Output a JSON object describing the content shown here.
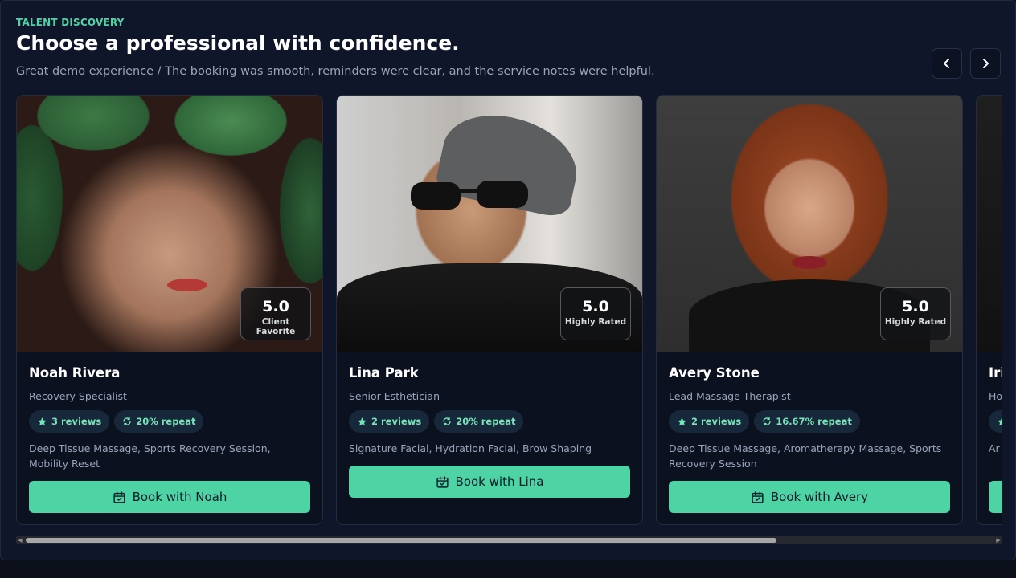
{
  "header": {
    "eyebrow": "TALENT DISCOVERY",
    "title": "Choose a professional with confidence.",
    "subtitle": "Great demo experience / The booking was smooth, reminders were clear, and the service notes were helpful."
  },
  "nav": {
    "prev_icon": "chevron-left-icon",
    "next_icon": "chevron-right-icon"
  },
  "colors": {
    "accent": "#4ed4a4",
    "background": "#0f1629",
    "card": "#0c1120"
  },
  "professionals": [
    {
      "name": "Noah Rivera",
      "role": "Recovery Specialist",
      "rating": "5.0",
      "rating_label": "Client Favorite",
      "reviews": "3 reviews",
      "repeat": "20% repeat",
      "services": "Deep Tissue Massage, Sports Recovery Session, Mobility Reset",
      "book_label": "Book with Noah"
    },
    {
      "name": "Lina Park",
      "role": "Senior Esthetician",
      "rating": "5.0",
      "rating_label": "Highly Rated",
      "reviews": "2 reviews",
      "repeat": "20% repeat",
      "services": "Signature Facial, Hydration Facial, Brow Shaping",
      "book_label": "Book with Lina"
    },
    {
      "name": "Avery Stone",
      "role": "Lead Massage Therapist",
      "rating": "5.0",
      "rating_label": "Highly Rated",
      "reviews": "2 reviews",
      "repeat": "16.67% repeat",
      "services": "Deep Tissue Massage, Aromatherapy Massage, Sports Recovery Session",
      "book_label": "Book with Avery"
    },
    {
      "name": "Iri",
      "role": "Ho",
      "services": "Ar"
    }
  ]
}
